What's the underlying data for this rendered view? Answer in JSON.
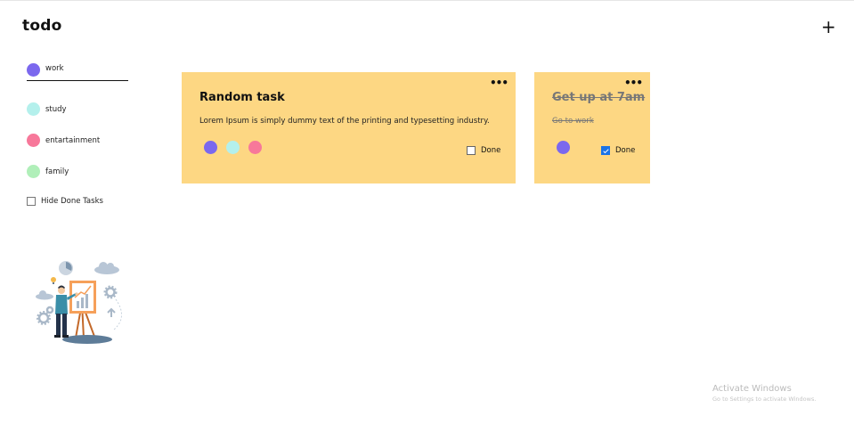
{
  "app": {
    "title": "todo",
    "add_label": "+"
  },
  "sidebar": {
    "categories": [
      {
        "label": "work",
        "color": "#7b68ee"
      },
      {
        "label": "study",
        "color": "#b4f0ec"
      },
      {
        "label": "entartainment",
        "color": "#f7789a"
      },
      {
        "label": "family",
        "color": "#b0efb9"
      }
    ],
    "hide_done_label": "Hide Done Tasks"
  },
  "tasks": [
    {
      "title": "Random task",
      "description": "Lorem Ipsum is simply dummy text of the printing and typesetting industry.",
      "tags": [
        "#7b68ee",
        "#b4f0ec",
        "#f7789a"
      ],
      "done_label": "Done",
      "done": false,
      "menu": "•••"
    },
    {
      "title": "Get up at 7am",
      "description": "Go to work",
      "tags": [
        "#7b68ee"
      ],
      "done_label": "Done",
      "done": true,
      "menu": "•••"
    }
  ],
  "card_color": "#fdd783",
  "watermark": {
    "line1": "Activate Windows",
    "line2": "Go to Settings to activate Windows."
  }
}
